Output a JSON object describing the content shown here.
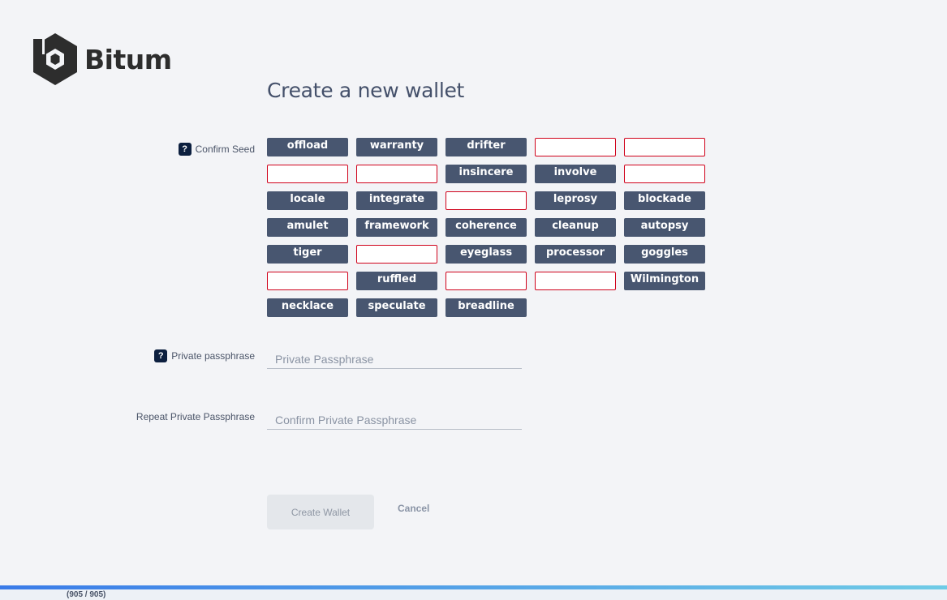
{
  "app": {
    "logo_text": "Bitum",
    "brand_color": "#2d2d2d"
  },
  "page": {
    "title": "Create a new wallet"
  },
  "confirm_seed": {
    "label": "Confirm Seed",
    "help_icon": "?",
    "words": [
      {
        "text": "offload",
        "filled": true
      },
      {
        "text": "warranty",
        "filled": true
      },
      {
        "text": "drifter",
        "filled": true
      },
      {
        "text": "",
        "filled": false
      },
      {
        "text": "",
        "filled": false
      },
      {
        "text": "",
        "filled": false
      },
      {
        "text": "",
        "filled": false
      },
      {
        "text": "insincere",
        "filled": true
      },
      {
        "text": "involve",
        "filled": true
      },
      {
        "text": "",
        "filled": false
      },
      {
        "text": "locale",
        "filled": true
      },
      {
        "text": "integrate",
        "filled": true
      },
      {
        "text": "",
        "filled": false
      },
      {
        "text": "leprosy",
        "filled": true
      },
      {
        "text": "blockade",
        "filled": true
      },
      {
        "text": "amulet",
        "filled": true
      },
      {
        "text": "framework",
        "filled": true
      },
      {
        "text": "coherence",
        "filled": true
      },
      {
        "text": "cleanup",
        "filled": true
      },
      {
        "text": "autopsy",
        "filled": true
      },
      {
        "text": "tiger",
        "filled": true
      },
      {
        "text": "",
        "filled": false
      },
      {
        "text": "eyeglass",
        "filled": true
      },
      {
        "text": "processor",
        "filled": true
      },
      {
        "text": "goggles",
        "filled": true
      },
      {
        "text": "",
        "filled": false
      },
      {
        "text": "ruffled",
        "filled": true
      },
      {
        "text": "",
        "filled": false
      },
      {
        "text": "",
        "filled": false
      },
      {
        "text": "Wilmington",
        "filled": true
      },
      {
        "text": "necklace",
        "filled": true
      },
      {
        "text": "speculate",
        "filled": true
      },
      {
        "text": "breadline",
        "filled": true
      }
    ]
  },
  "private_passphrase": {
    "label": "Private passphrase",
    "help_icon": "?",
    "placeholder": "Private Passphrase",
    "value": ""
  },
  "repeat_passphrase": {
    "label": "Repeat Private Passphrase",
    "placeholder": "Confirm Private Passphrase",
    "value": ""
  },
  "actions": {
    "create_label": "Create Wallet",
    "cancel_label": "Cancel"
  },
  "progress": {
    "text": "(905 / 905)",
    "fraction": 1.0
  },
  "colors": {
    "background": "#f3f4f7",
    "seed_word": "#485670",
    "seed_missing_border": "#d0021b",
    "help_icon": "#0c1f3f",
    "progress_start": "#3a7be8",
    "progress_end": "#6fcbe6"
  }
}
